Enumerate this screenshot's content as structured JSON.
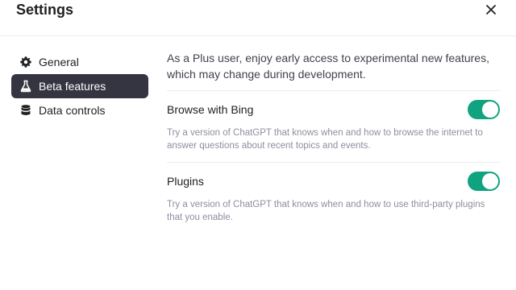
{
  "header": {
    "title": "Settings",
    "close_icon": "close-icon"
  },
  "sidebar": {
    "items": [
      {
        "label": "General",
        "icon": "gear-icon",
        "active": false
      },
      {
        "label": "Beta features",
        "icon": "flask-icon",
        "active": true
      },
      {
        "label": "Data controls",
        "icon": "database-icon",
        "active": false
      }
    ]
  },
  "main": {
    "intro": "As a Plus user, enjoy early access to experimental new features, which may change during development.",
    "features": [
      {
        "title": "Browse with Bing",
        "description": "Try a version of ChatGPT that knows when and how to browse the internet to answer questions about recent topics and events.",
        "enabled": true
      },
      {
        "title": "Plugins",
        "description": "Try a version of ChatGPT that knows when and how to use third-party plugins that you enable.",
        "enabled": true
      }
    ]
  },
  "colors": {
    "accent": "#10a37f",
    "active_nav_bg": "#343541",
    "muted_text": "#8e8ea0"
  }
}
